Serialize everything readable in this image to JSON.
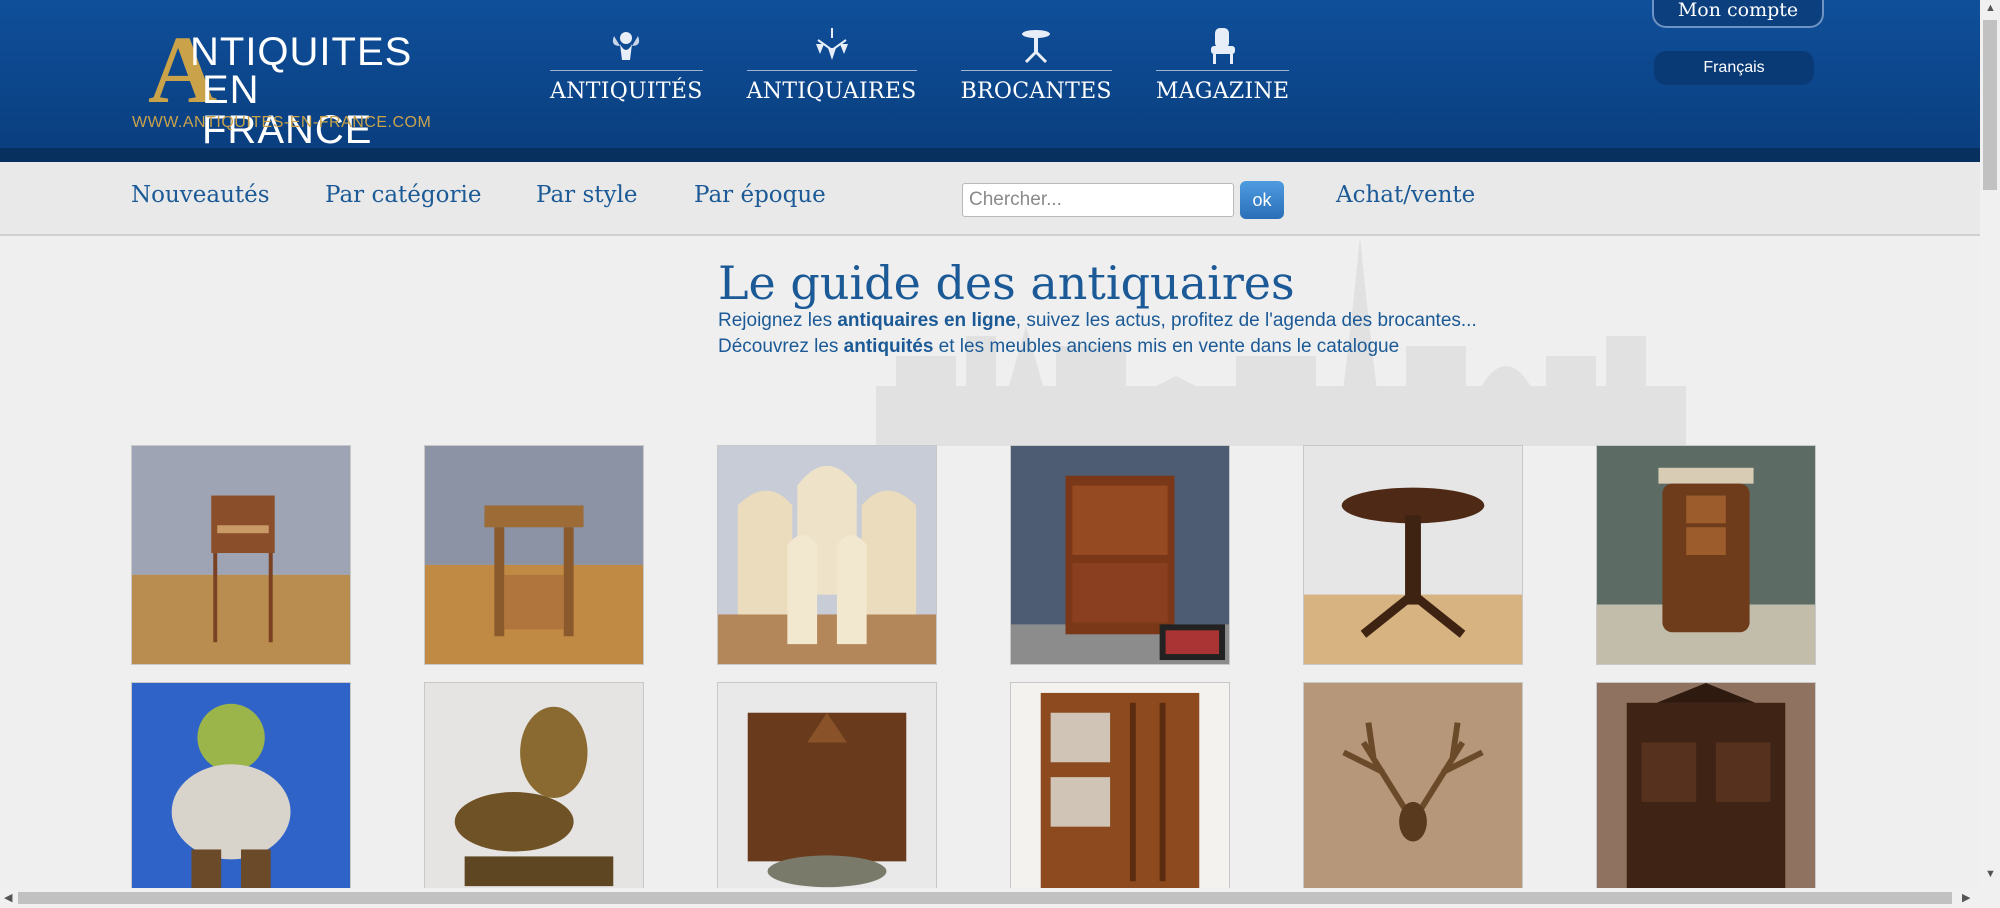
{
  "header": {
    "logo": {
      "big_letter": "A",
      "line1": "NTIQUITES",
      "line2": "EN FRANCE",
      "url": "WWW.ANTIQUITES-EN-FRANCE.COM"
    },
    "nav": [
      {
        "label": "ANTIQUITÉS",
        "icon": "cherub-icon"
      },
      {
        "label": "ANTIQUAIRES",
        "icon": "chandelier-icon"
      },
      {
        "label": "BROCANTES",
        "icon": "pedestal-table-icon"
      },
      {
        "label": "MAGAZINE",
        "icon": "armchair-icon"
      }
    ],
    "account_label": "Mon compte",
    "language": "Français"
  },
  "subnav": {
    "links": [
      "Nouveautés",
      "Par catégorie",
      "Par style",
      "Par époque"
    ],
    "search_placeholder": "Chercher...",
    "search_button": "ok",
    "achat_label": "Achat/vente"
  },
  "main": {
    "title": "Le guide des antiquaires",
    "intro1": {
      "a": "Rejoignez les ",
      "b": "antiquaires en ligne",
      "c": ", suivez les actus, profitez de l'agenda des brocantes..."
    },
    "intro2": {
      "a": "Découvrez les ",
      "b": "antiquités",
      "c": " et les meubles anciens mis en vente dans le catalogue"
    }
  },
  "colors": {
    "header_blue": "#0d4a92",
    "link_blue": "#1b5a96",
    "gold": "#c9a24a"
  }
}
